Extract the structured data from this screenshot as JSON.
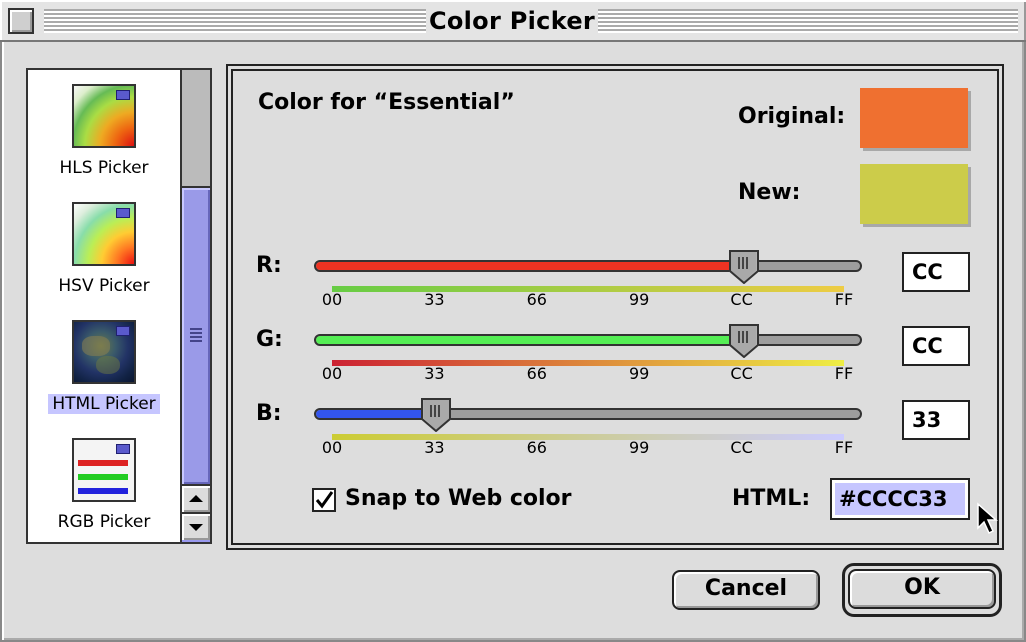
{
  "window": {
    "title": "Color Picker"
  },
  "picker_list": {
    "items": [
      {
        "label": "HLS Picker",
        "icon": "hls-color-wheel-icon",
        "selected": false
      },
      {
        "label": "HSV Picker",
        "icon": "hsv-color-wheel-icon",
        "selected": false
      },
      {
        "label": "HTML Picker",
        "icon": "globe-icon",
        "selected": true
      },
      {
        "label": "RGB Picker",
        "icon": "rgb-bars-icon",
        "selected": false
      }
    ]
  },
  "main": {
    "color_for": "Color for “Essential”",
    "original_label": "Original:",
    "new_label": "New:",
    "original_color": "#ef7030",
    "new_color": "#cccc4a",
    "tick_labels": [
      "00",
      "33",
      "66",
      "99",
      "CC",
      "FF"
    ],
    "channels": [
      {
        "label": "R:",
        "value": "CC",
        "level": 0.8,
        "fill_color": "#ee3322",
        "gradient": [
          "#66cc44",
          "#eecc44"
        ]
      },
      {
        "label": "G:",
        "value": "CC",
        "level": 0.8,
        "fill_color": "#55ee55",
        "gradient": [
          "#cc2233",
          "#eeee44"
        ]
      },
      {
        "label": "B:",
        "value": "33",
        "level": 0.2,
        "fill_color": "#3355ee",
        "gradient": [
          "#cccc33",
          "#ccccff"
        ]
      }
    ],
    "snap_label": "Snap to Web color",
    "snap_checked": true,
    "html_label": "HTML:",
    "html_value": "#CCCC33"
  },
  "buttons": {
    "cancel": "Cancel",
    "ok": "OK"
  }
}
